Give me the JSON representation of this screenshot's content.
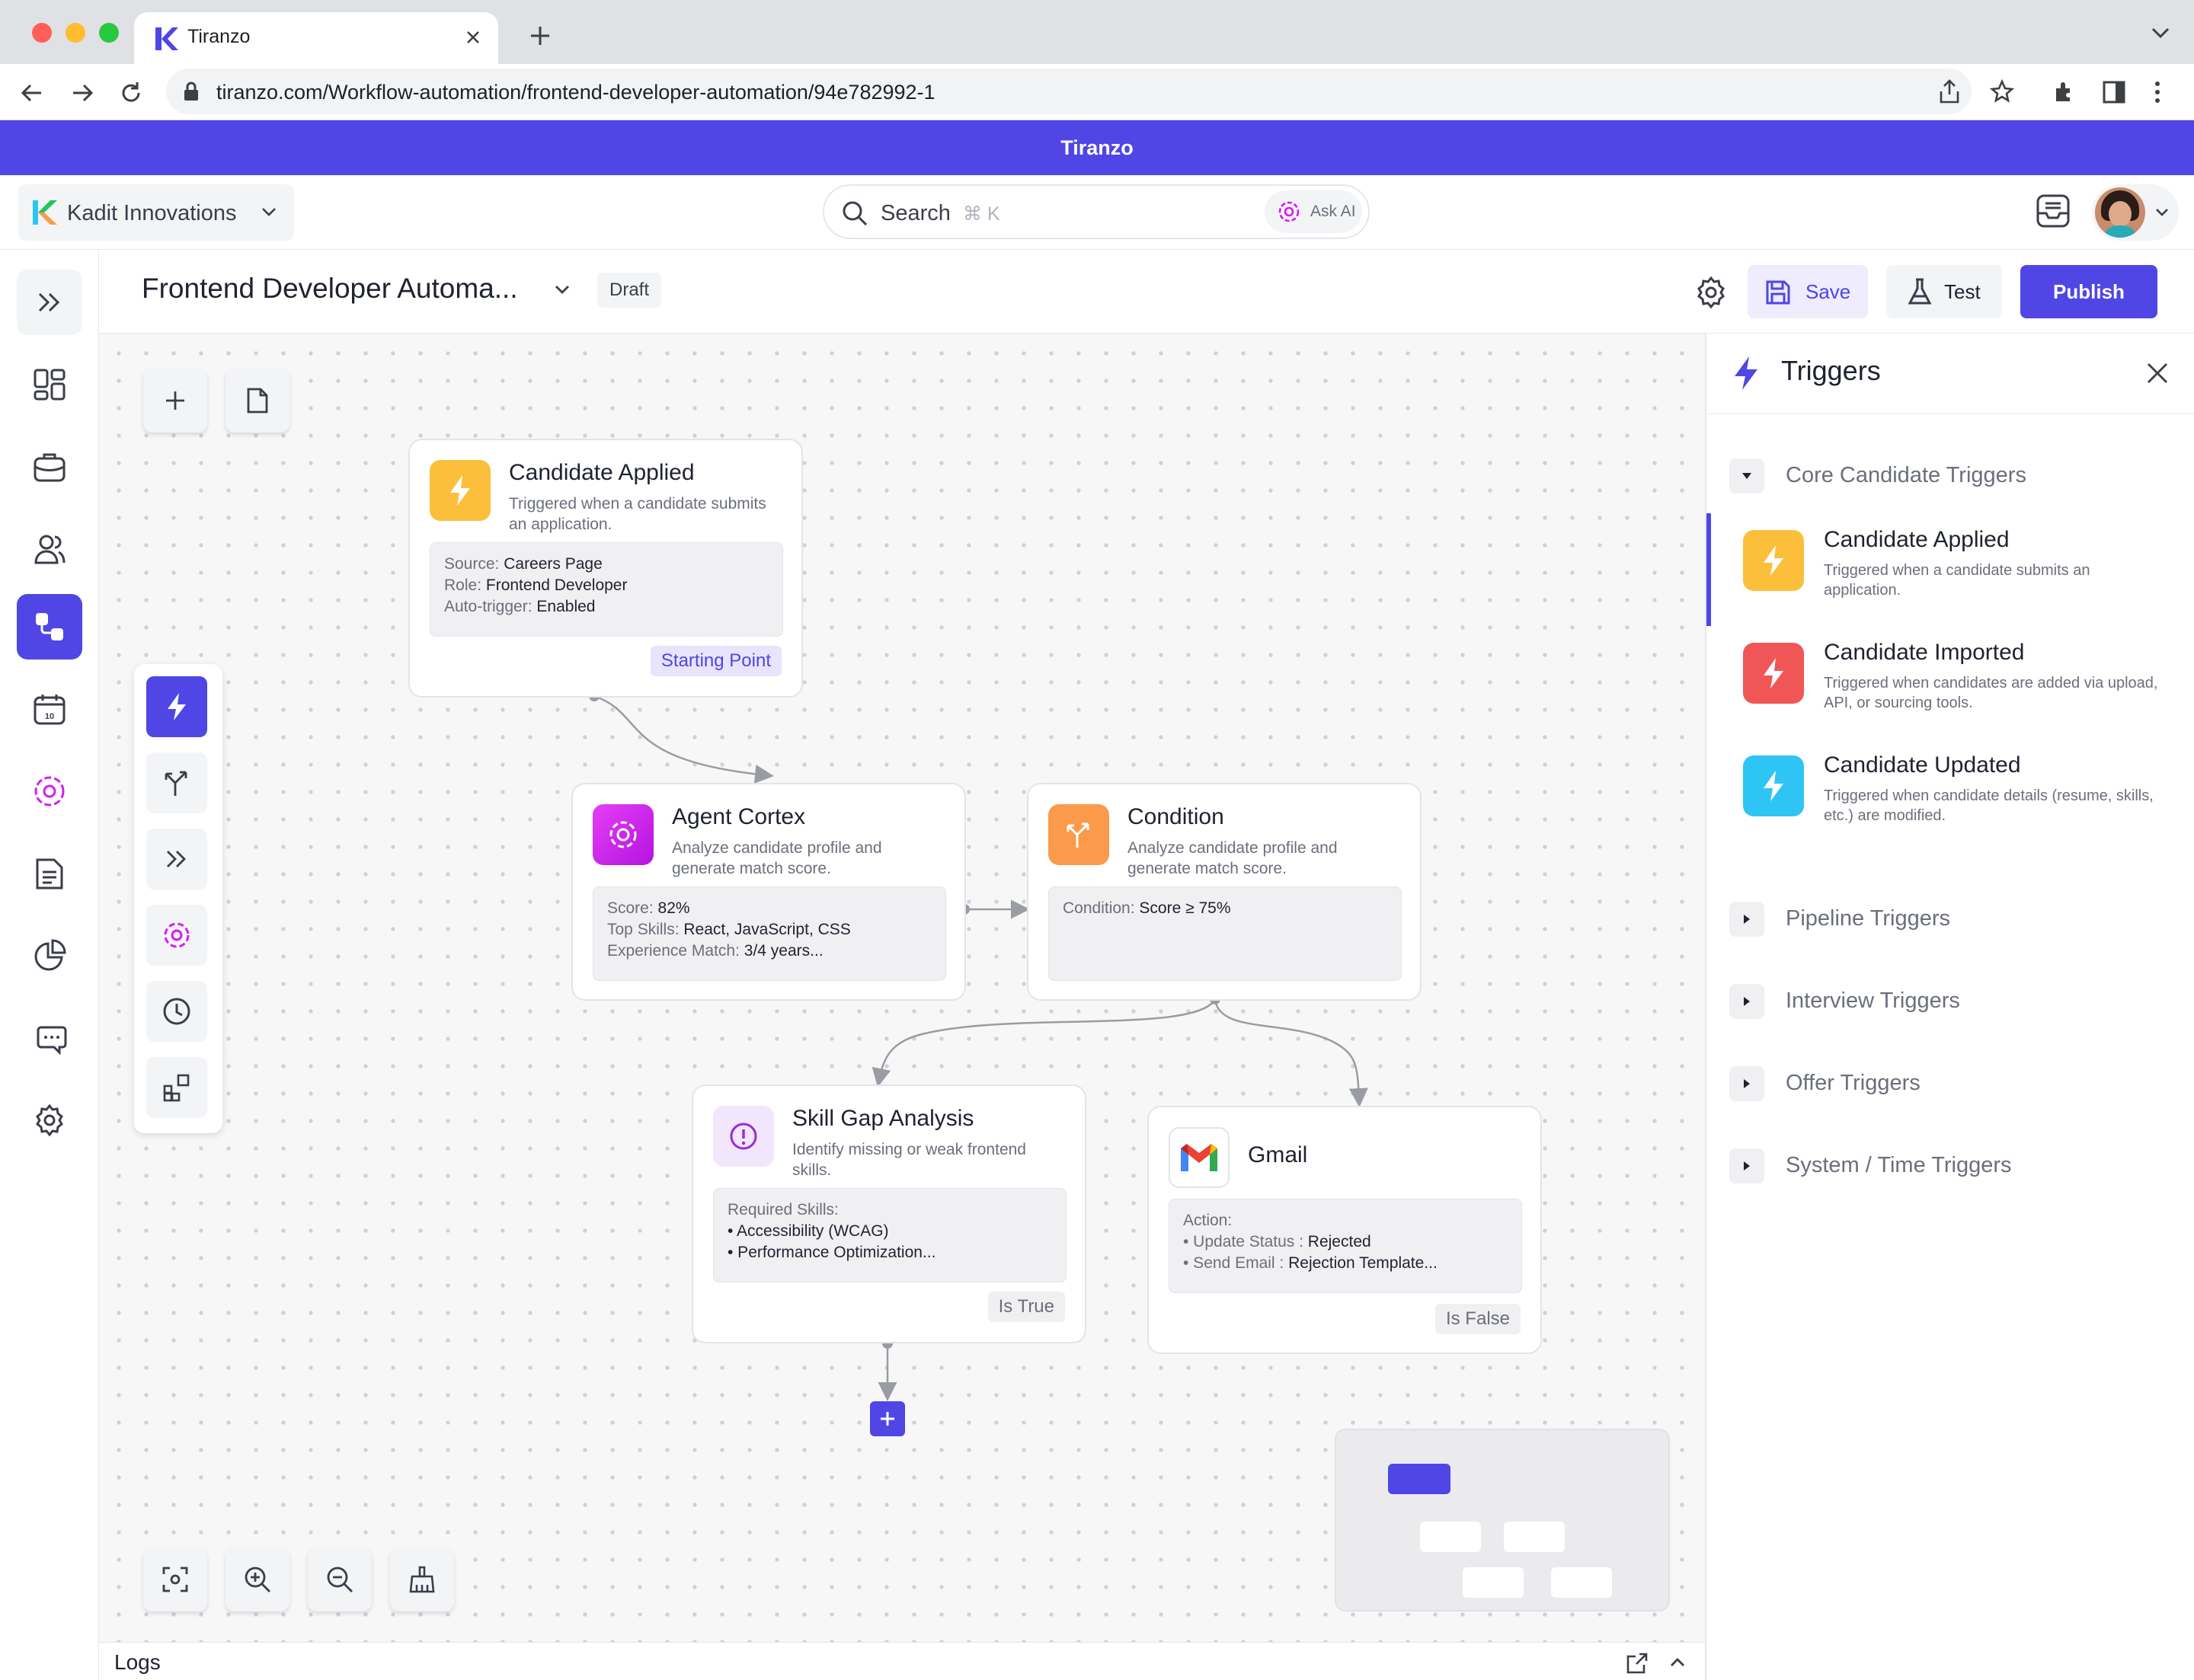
{
  "browser": {
    "tab_title": "Tiranzo",
    "url": "tiranzo.com/Workflow-automation/frontend-developer-automation/94e782992-1"
  },
  "banner": {
    "title": "Tiranzo"
  },
  "header": {
    "org_name": "Kadit Innovations",
    "search_placeholder": "Search",
    "search_shortcut": "⌘ K",
    "ask_ai_label": "Ask AI"
  },
  "toolbar": {
    "workflow_title": "Frontend Developer Automa...",
    "status_badge": "Draft",
    "save_label": "Save",
    "test_label": "Test",
    "publish_label": "Publish"
  },
  "nodes": {
    "candidate_applied": {
      "title": "Candidate Applied",
      "description": "Triggered when a candidate submits an application.",
      "details": [
        {
          "key": "Source:",
          "value": "Careers Page"
        },
        {
          "key": "Role:",
          "value": "Frontend Developer"
        },
        {
          "key": "Auto-trigger:",
          "value": "Enabled"
        }
      ],
      "tag": "Starting Point"
    },
    "agent_cortex": {
      "title": "Agent Cortex",
      "description": "Analyze candidate profile and generate match score.",
      "details": [
        {
          "key": "Score:",
          "value": "82%"
        },
        {
          "key": "Top Skills:",
          "value": "React, JavaScript, CSS"
        },
        {
          "key": "Experience Match:",
          "value": "3/4 years..."
        }
      ]
    },
    "condition": {
      "title": "Condition",
      "description": "Analyze candidate profile and generate match score.",
      "details": [
        {
          "key": "Condition:",
          "value": "Score ≥ 75%"
        }
      ]
    },
    "skill_gap": {
      "title": "Skill Gap Analysis",
      "description": "Identify missing or weak frontend skills.",
      "details_header": "Required Skills:",
      "details": [
        "• Accessibility (WCAG)",
        "• Performance Optimization..."
      ],
      "tag": "Is True"
    },
    "gmail": {
      "title": "Gmail",
      "details_header": "Action:",
      "details": [
        {
          "key": "• Update Status :",
          "value": "Rejected"
        },
        {
          "key": "• Send Email :",
          "value": "Rejection Template..."
        }
      ],
      "tag": "Is False"
    }
  },
  "logs": {
    "label": "Logs"
  },
  "panel": {
    "title": "Triggers",
    "groups": {
      "core": {
        "label": "Core Candidate Triggers",
        "items": [
          {
            "name": "Candidate Applied",
            "description": "Triggered when a candidate submits an application.",
            "color": "#fbbf3c"
          },
          {
            "name": "Candidate Imported",
            "description": "Triggered when candidates are added via upload, API, or sourcing tools.",
            "color": "#f05656"
          },
          {
            "name": "Candidate Updated",
            "description": "Triggered when candidate details (resume, skills, etc.) are modified.",
            "color": "#2ec5f5"
          }
        ]
      },
      "collapsed": [
        "Pipeline Triggers",
        "Interview Triggers",
        "Offer Triggers",
        "System / Time Triggers"
      ]
    }
  },
  "colors": {
    "brand": "#4f46e5",
    "trigger_yellow": "#fbbf3c",
    "cortex_magenta": "#d21ff0",
    "condition_orange": "#fb9a4a",
    "skill_gap_purple": "#f1e6fb"
  },
  "icons": [
    "kadit-logo-icon",
    "search-icon",
    "sparkle-icon",
    "inbox-icon",
    "avatar",
    "chevron-down-icon",
    "expand-icon",
    "dashboard-icon",
    "briefcase-icon",
    "users-icon",
    "workflow-icon",
    "calendar-icon",
    "cortex-icon",
    "document-icon",
    "pie-chart-icon",
    "chat-icon",
    "gear-icon",
    "save-icon",
    "flask-icon",
    "bolt-icon",
    "branch-icon",
    "fast-forward-icon",
    "clock-icon",
    "widgets-icon",
    "plus-icon",
    "file-icon",
    "fit-view-icon",
    "zoom-in-icon",
    "zoom-out-icon",
    "broom-icon",
    "alert-icon",
    "gmail-icon",
    "external-link-icon",
    "chevron-up-icon",
    "close-icon"
  ]
}
